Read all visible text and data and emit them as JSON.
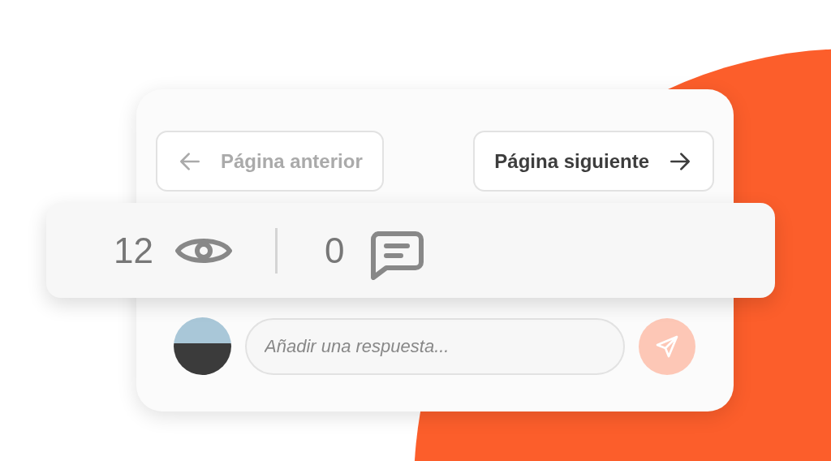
{
  "pagination": {
    "previous": {
      "label": "Página anterior",
      "disabled": true
    },
    "next": {
      "label": "Página siguiente",
      "disabled": false
    }
  },
  "stats": {
    "views": "12",
    "comments": "0"
  },
  "reply": {
    "placeholder": "Añadir una respuesta...",
    "send_disabled": true
  }
}
